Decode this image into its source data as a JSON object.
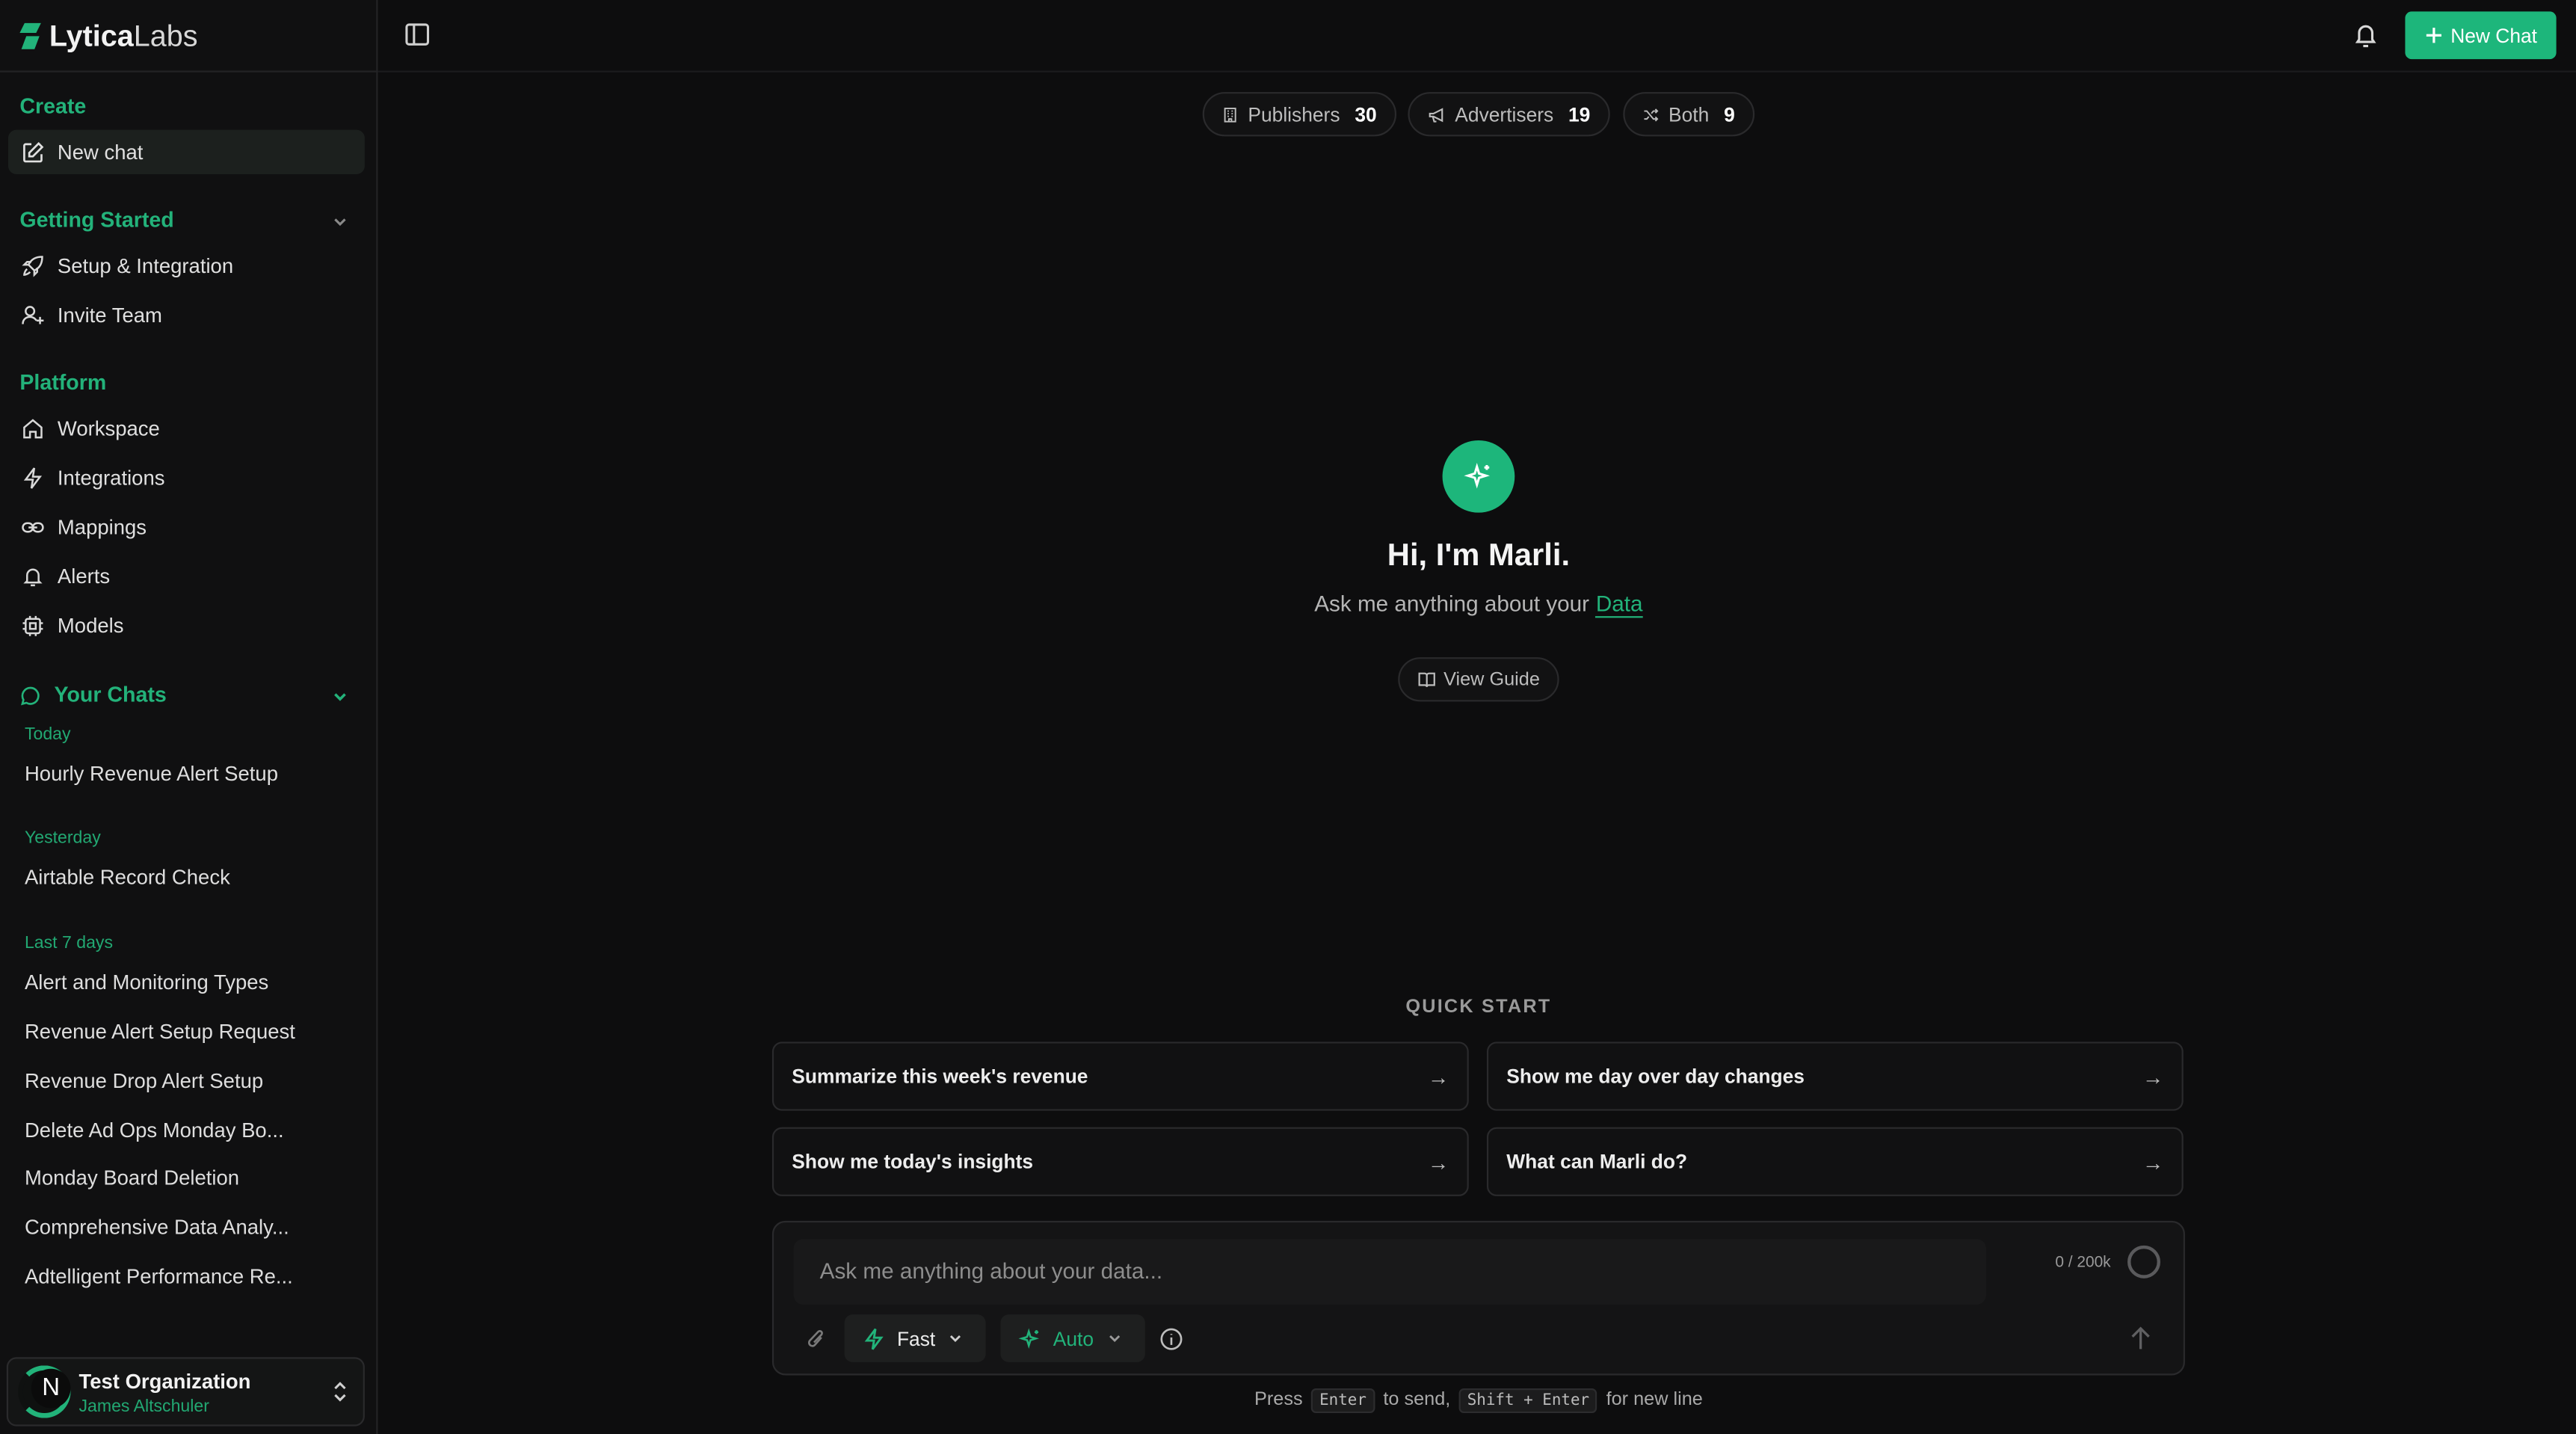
{
  "brand": {
    "name_strong": "Lytica",
    "name_light": "Labs",
    "accent_color": "#1db67b"
  },
  "sidebar": {
    "create_label": "Create",
    "new_chat_label": "New chat",
    "getting_started_label": "Getting Started",
    "getting_started_items": [
      {
        "label": "Setup & Integration",
        "icon": "rocket-icon"
      },
      {
        "label": "Invite Team",
        "icon": "user-plus-icon"
      }
    ],
    "platform_label": "Platform",
    "platform_items": [
      {
        "label": "Workspace",
        "icon": "home-icon"
      },
      {
        "label": "Integrations",
        "icon": "bolt-icon"
      },
      {
        "label": "Mappings",
        "icon": "link-icon"
      },
      {
        "label": "Alerts",
        "icon": "bell-icon"
      },
      {
        "label": "Models",
        "icon": "chip-icon"
      }
    ],
    "your_chats_label": "Your Chats",
    "groups": [
      {
        "label": "Today",
        "chats": [
          "Hourly Revenue Alert Setup"
        ]
      },
      {
        "label": "Yesterday",
        "chats": [
          "Airtable Record Check"
        ]
      },
      {
        "label": "Last 7 days",
        "chats": [
          "Alert and Monitoring Types",
          "Revenue Alert Setup Request",
          "Revenue Drop Alert Setup",
          "Delete Ad Ops Monday Bo...",
          "Monday Board Deletion",
          "Comprehensive Data Analy...",
          "Adtelligent Performance Re..."
        ]
      }
    ],
    "org": {
      "initial": "N",
      "name": "Test Organization",
      "user": "James Altschuler"
    }
  },
  "header": {
    "new_chat_button": "New Chat"
  },
  "stats": [
    {
      "label": "Publishers",
      "count": "30",
      "icon": "building-icon"
    },
    {
      "label": "Advertisers",
      "count": "19",
      "icon": "megaphone-icon"
    },
    {
      "label": "Both",
      "count": "9",
      "icon": "shuffle-icon"
    }
  ],
  "hero": {
    "title": "Hi, I'm Marli.",
    "subtitle": "Ask me anything about your",
    "subtitle_accent": "Data",
    "guide_button": "View Guide"
  },
  "quick_start": {
    "label": "QUICK START",
    "items": [
      "Summarize this week's revenue",
      "Show me day over day changes",
      "Show me today's insights",
      "What can Marli do?"
    ]
  },
  "composer": {
    "placeholder": "Ask me anything about your data...",
    "char_count": "0 / 200k",
    "speed_label": "Fast",
    "model_label": "Auto"
  },
  "hint": {
    "press": "Press",
    "key_enter": "Enter",
    "to_send": "to send,",
    "key_shift_enter": "Shift + Enter",
    "new_line": "for new line"
  }
}
